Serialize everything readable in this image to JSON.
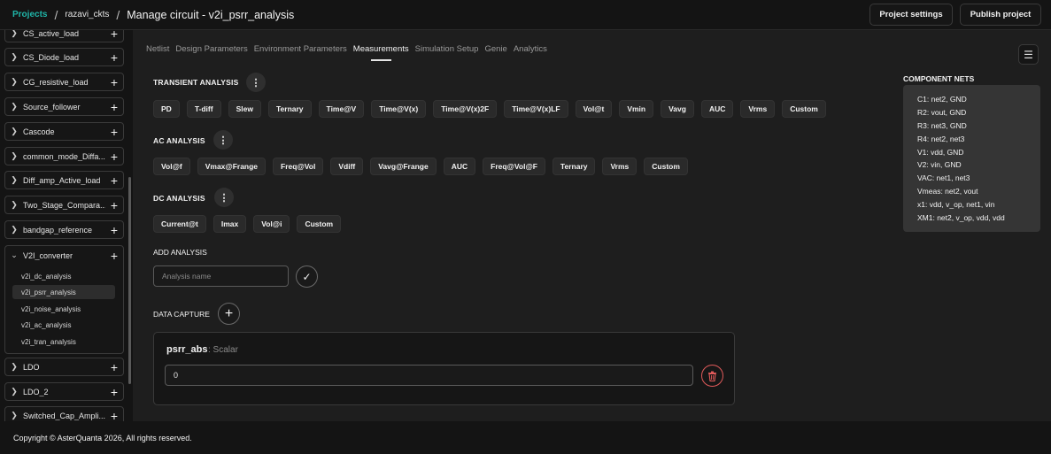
{
  "header": {
    "crumb_projects": "Projects",
    "crumb_project": "razavi_ckts",
    "title": "Manage circuit - v2i_psrr_analysis",
    "project_settings": "Project settings",
    "publish_project": "Publish project"
  },
  "sidebar": {
    "items": [
      {
        "label": "CS_active_load"
      },
      {
        "label": "CS_Diode_load"
      },
      {
        "label": "CG_resistive_load"
      },
      {
        "label": "Source_follower"
      },
      {
        "label": "Cascode"
      },
      {
        "label": "common_mode_Diffa..."
      },
      {
        "label": "Diff_amp_Active_load"
      },
      {
        "label": "Two_Stage_Compara..."
      },
      {
        "label": "bandgap_reference"
      }
    ],
    "expanded": {
      "label": "V2I_converter",
      "children": [
        {
          "label": "v2i_dc_analysis"
        },
        {
          "label": "v2i_psrr_analysis"
        },
        {
          "label": "v2i_noise_analysis"
        },
        {
          "label": "v2i_ac_analysis"
        },
        {
          "label": "v2i_tran_analysis"
        }
      ]
    },
    "items_after": [
      {
        "label": "LDO"
      },
      {
        "label": "LDO_2"
      },
      {
        "label": "Switched_Cap_Ampli..."
      }
    ]
  },
  "tabs": [
    "Netlist",
    "Design Parameters",
    "Environment Parameters",
    "Measurements",
    "Simulation Setup",
    "Genie",
    "Analytics"
  ],
  "transient": {
    "title": "TRANSIENT ANALYSIS",
    "chips": [
      "PD",
      "T-diff",
      "Slew",
      "Ternary",
      "Time@V",
      "Time@V(x)",
      "Time@V(x)2F",
      "Time@V(x)LF",
      "Vol@t",
      "Vmin",
      "Vavg",
      "AUC",
      "Vrms",
      "Custom"
    ]
  },
  "ac": {
    "title": "AC ANALYSIS",
    "chips": [
      "Vol@f",
      "Vmax@Frange",
      "Freq@Vol",
      "Vdiff",
      "Vavg@Frange",
      "AUC",
      "Freq@Vol@F",
      "Ternary",
      "Vrms",
      "Custom"
    ]
  },
  "dc": {
    "title": "DC ANALYSIS",
    "chips": [
      "Current@t",
      "Imax",
      "Vol@i",
      "Custom"
    ]
  },
  "add_analysis": {
    "label": "ADD ANALYSIS",
    "placeholder": "Analysis name"
  },
  "data_capture": {
    "label": "DATA CAPTURE",
    "item": {
      "name": "psrr_abs",
      "type": ": Scalar",
      "value": "0"
    }
  },
  "nets": {
    "title": "COMPONENT NETS",
    "lines": [
      "C1: net2, GND",
      "R2: vout, GND",
      "R3: net3, GND",
      "R4: net2, net3",
      "V1: vdd, GND",
      "V2: vin, GND",
      "VAC: net1, net3",
      "Vmeas: net2, vout",
      "x1: vdd, v_op, net1, vin",
      "XM1: net2, v_op, vdd, vdd"
    ]
  },
  "footer": {
    "text": "Copyright © AsterQuanta 2026, All rights reserved."
  }
}
